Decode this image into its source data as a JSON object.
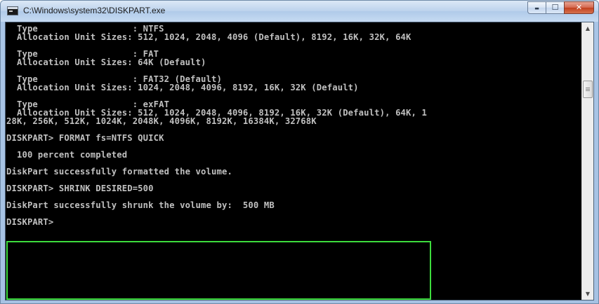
{
  "window": {
    "title": "C:\\Windows\\system32\\DISKPART.exe",
    "caption_buttons": {
      "minimize_glyph": "▬",
      "maximize_glyph": "☐",
      "close_glyph": "✕"
    }
  },
  "console": {
    "lines": [
      "  Type                  : NTFS",
      "  Allocation Unit Sizes: 512, 1024, 2048, 4096 (Default), 8192, 16K, 32K, 64K",
      "",
      "  Type                  : FAT",
      "  Allocation Unit Sizes: 64K (Default)",
      "",
      "  Type                  : FAT32 (Default)",
      "  Allocation Unit Sizes: 1024, 2048, 4096, 8192, 16K, 32K (Default)",
      "",
      "  Type                  : exFAT",
      "  Allocation Unit Sizes: 512, 1024, 2048, 4096, 8192, 16K, 32K (Default), 64K, 1",
      "28K, 256K, 512K, 1024K, 2048K, 4096K, 8192K, 16384K, 32768K",
      "",
      "DISKPART> FORMAT fs=NTFS QUICK",
      "",
      "  100 percent completed",
      "",
      "DiskPart successfully formatted the volume.",
      "",
      "DISKPART> SHRINK DESIRED=500",
      "",
      "DiskPart successfully shrunk the volume by:  500 MB",
      "",
      "DISKPART> "
    ]
  },
  "scrollbar": {
    "up_glyph": "▲",
    "down_glyph": "▼"
  },
  "colors": {
    "console_background": "#000000",
    "console_text": "#c0c0c0",
    "highlight_border": "#3ddc3d"
  }
}
